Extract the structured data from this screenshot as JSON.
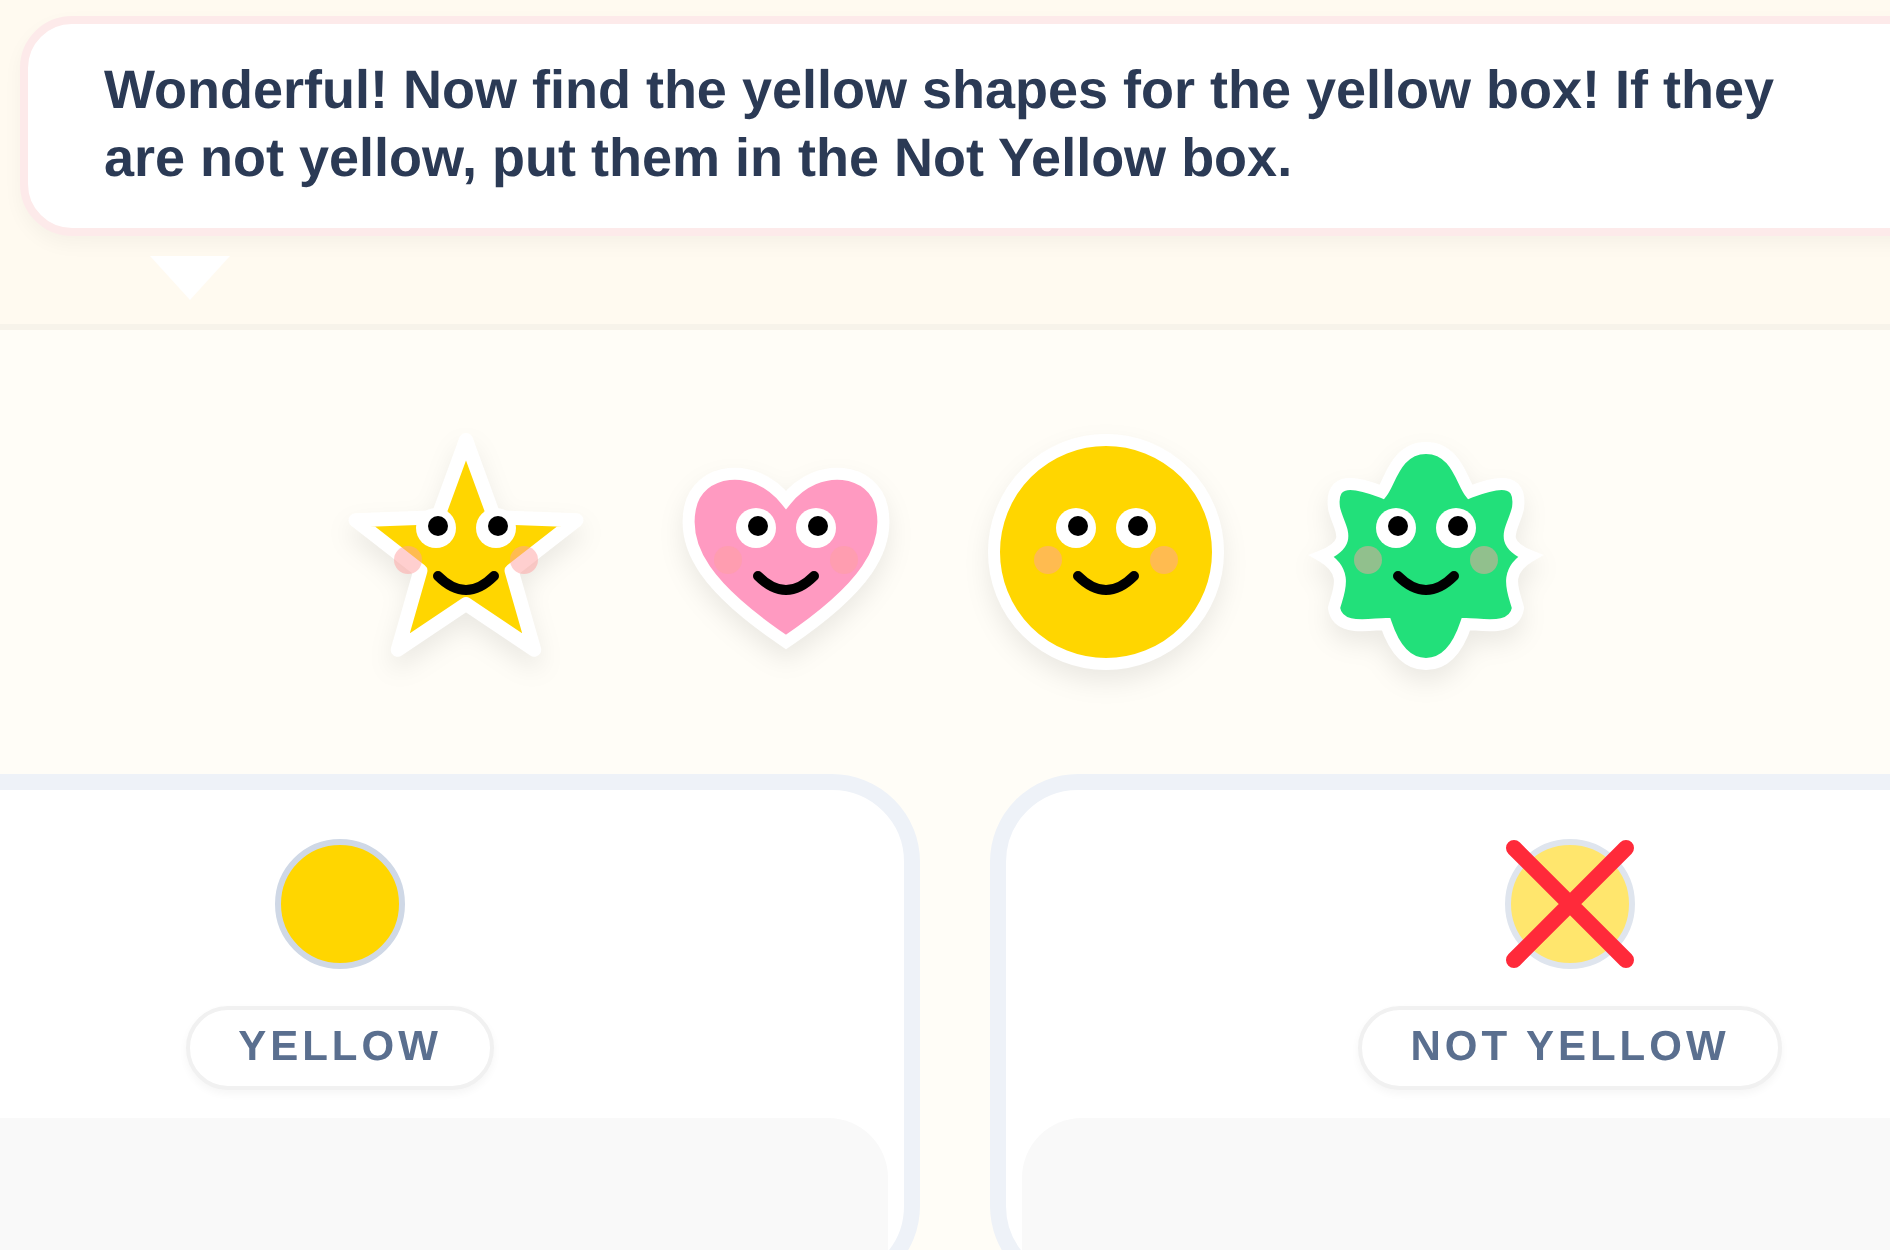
{
  "instruction": {
    "text": "Wonderful! Now find the yellow shapes for the yellow box! If they are not yellow, put them in the Not Yellow box."
  },
  "shapes": [
    {
      "kind": "star",
      "color": "#ffd600"
    },
    {
      "kind": "heart",
      "color": "#ff9ac1"
    },
    {
      "kind": "circle",
      "color": "#ffd600"
    },
    {
      "kind": "blob",
      "color": "#22e07a"
    }
  ],
  "bins": [
    {
      "label": "YELLOW",
      "kind": "yellow"
    },
    {
      "label": "NOT YELLOW",
      "kind": "not-yellow"
    }
  ]
}
